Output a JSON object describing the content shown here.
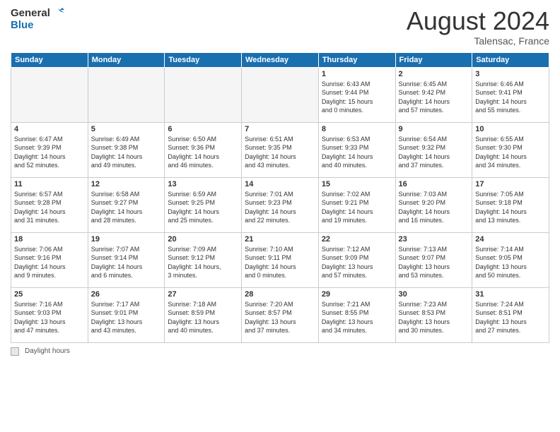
{
  "header": {
    "logo_line1": "General",
    "logo_line2": "Blue",
    "month_title": "August 2024",
    "location": "Talensac, France"
  },
  "weekdays": [
    "Sunday",
    "Monday",
    "Tuesday",
    "Wednesday",
    "Thursday",
    "Friday",
    "Saturday"
  ],
  "weeks": [
    [
      {
        "day": "",
        "info": ""
      },
      {
        "day": "",
        "info": ""
      },
      {
        "day": "",
        "info": ""
      },
      {
        "day": "",
        "info": ""
      },
      {
        "day": "1",
        "info": "Sunrise: 6:43 AM\nSunset: 9:44 PM\nDaylight: 15 hours\nand 0 minutes."
      },
      {
        "day": "2",
        "info": "Sunrise: 6:45 AM\nSunset: 9:42 PM\nDaylight: 14 hours\nand 57 minutes."
      },
      {
        "day": "3",
        "info": "Sunrise: 6:46 AM\nSunset: 9:41 PM\nDaylight: 14 hours\nand 55 minutes."
      }
    ],
    [
      {
        "day": "4",
        "info": "Sunrise: 6:47 AM\nSunset: 9:39 PM\nDaylight: 14 hours\nand 52 minutes."
      },
      {
        "day": "5",
        "info": "Sunrise: 6:49 AM\nSunset: 9:38 PM\nDaylight: 14 hours\nand 49 minutes."
      },
      {
        "day": "6",
        "info": "Sunrise: 6:50 AM\nSunset: 9:36 PM\nDaylight: 14 hours\nand 46 minutes."
      },
      {
        "day": "7",
        "info": "Sunrise: 6:51 AM\nSunset: 9:35 PM\nDaylight: 14 hours\nand 43 minutes."
      },
      {
        "day": "8",
        "info": "Sunrise: 6:53 AM\nSunset: 9:33 PM\nDaylight: 14 hours\nand 40 minutes."
      },
      {
        "day": "9",
        "info": "Sunrise: 6:54 AM\nSunset: 9:32 PM\nDaylight: 14 hours\nand 37 minutes."
      },
      {
        "day": "10",
        "info": "Sunrise: 6:55 AM\nSunset: 9:30 PM\nDaylight: 14 hours\nand 34 minutes."
      }
    ],
    [
      {
        "day": "11",
        "info": "Sunrise: 6:57 AM\nSunset: 9:28 PM\nDaylight: 14 hours\nand 31 minutes."
      },
      {
        "day": "12",
        "info": "Sunrise: 6:58 AM\nSunset: 9:27 PM\nDaylight: 14 hours\nand 28 minutes."
      },
      {
        "day": "13",
        "info": "Sunrise: 6:59 AM\nSunset: 9:25 PM\nDaylight: 14 hours\nand 25 minutes."
      },
      {
        "day": "14",
        "info": "Sunrise: 7:01 AM\nSunset: 9:23 PM\nDaylight: 14 hours\nand 22 minutes."
      },
      {
        "day": "15",
        "info": "Sunrise: 7:02 AM\nSunset: 9:21 PM\nDaylight: 14 hours\nand 19 minutes."
      },
      {
        "day": "16",
        "info": "Sunrise: 7:03 AM\nSunset: 9:20 PM\nDaylight: 14 hours\nand 16 minutes."
      },
      {
        "day": "17",
        "info": "Sunrise: 7:05 AM\nSunset: 9:18 PM\nDaylight: 14 hours\nand 13 minutes."
      }
    ],
    [
      {
        "day": "18",
        "info": "Sunrise: 7:06 AM\nSunset: 9:16 PM\nDaylight: 14 hours\nand 9 minutes."
      },
      {
        "day": "19",
        "info": "Sunrise: 7:07 AM\nSunset: 9:14 PM\nDaylight: 14 hours\nand 6 minutes."
      },
      {
        "day": "20",
        "info": "Sunrise: 7:09 AM\nSunset: 9:12 PM\nDaylight: 14 hours,\n3 minutes."
      },
      {
        "day": "21",
        "info": "Sunrise: 7:10 AM\nSunset: 9:11 PM\nDaylight: 14 hours\nand 0 minutes."
      },
      {
        "day": "22",
        "info": "Sunrise: 7:12 AM\nSunset: 9:09 PM\nDaylight: 13 hours\nand 57 minutes."
      },
      {
        "day": "23",
        "info": "Sunrise: 7:13 AM\nSunset: 9:07 PM\nDaylight: 13 hours\nand 53 minutes."
      },
      {
        "day": "24",
        "info": "Sunrise: 7:14 AM\nSunset: 9:05 PM\nDaylight: 13 hours\nand 50 minutes."
      }
    ],
    [
      {
        "day": "25",
        "info": "Sunrise: 7:16 AM\nSunset: 9:03 PM\nDaylight: 13 hours\nand 47 minutes."
      },
      {
        "day": "26",
        "info": "Sunrise: 7:17 AM\nSunset: 9:01 PM\nDaylight: 13 hours\nand 43 minutes."
      },
      {
        "day": "27",
        "info": "Sunrise: 7:18 AM\nSunset: 8:59 PM\nDaylight: 13 hours\nand 40 minutes."
      },
      {
        "day": "28",
        "info": "Sunrise: 7:20 AM\nSunset: 8:57 PM\nDaylight: 13 hours\nand 37 minutes."
      },
      {
        "day": "29",
        "info": "Sunrise: 7:21 AM\nSunset: 8:55 PM\nDaylight: 13 hours\nand 34 minutes."
      },
      {
        "day": "30",
        "info": "Sunrise: 7:23 AM\nSunset: 8:53 PM\nDaylight: 13 hours\nand 30 minutes."
      },
      {
        "day": "31",
        "info": "Sunrise: 7:24 AM\nSunset: 8:51 PM\nDaylight: 13 hours\nand 27 minutes."
      }
    ]
  ],
  "footer": {
    "daylight_label": "Daylight hours"
  }
}
